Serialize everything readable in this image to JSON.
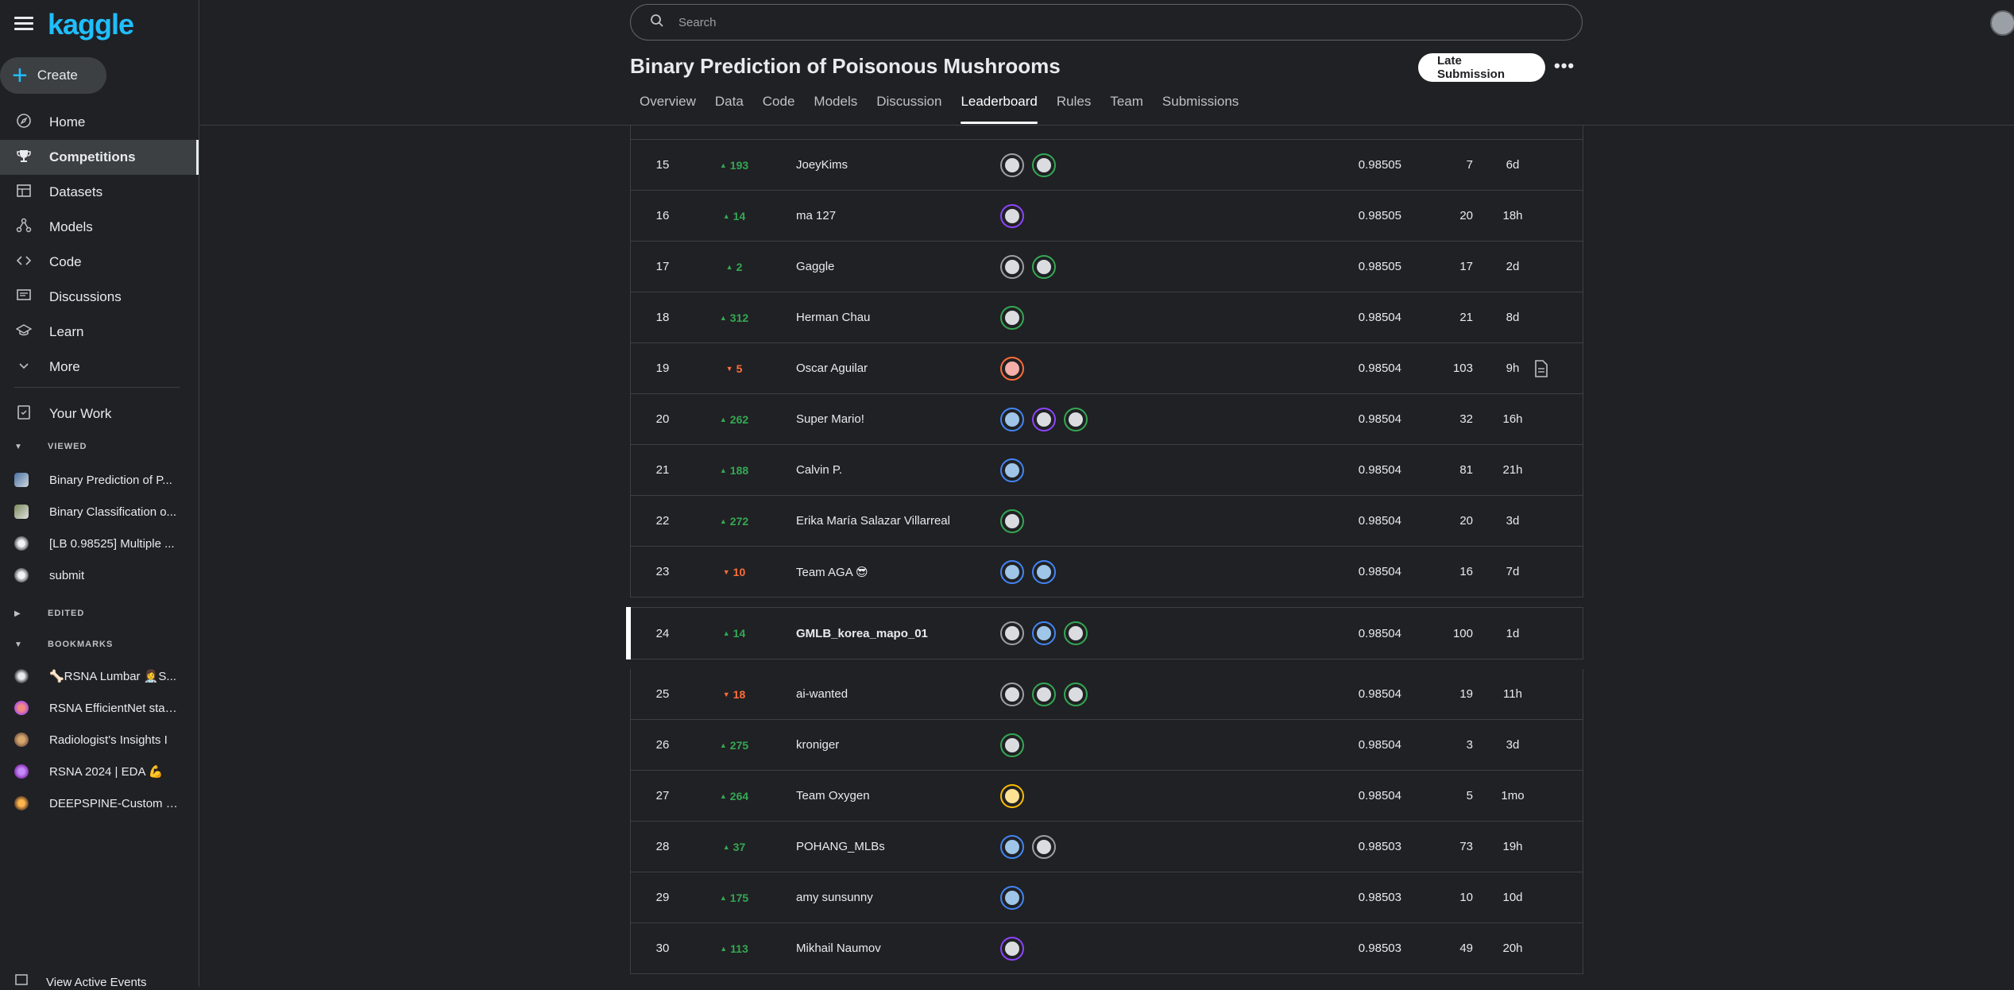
{
  "app": {
    "logo": "kaggle"
  },
  "sidebar": {
    "create_label": "Create",
    "nav": [
      {
        "label": "Home",
        "icon": "compass-icon"
      },
      {
        "label": "Competitions",
        "icon": "trophy-icon",
        "active": true
      },
      {
        "label": "Datasets",
        "icon": "table-icon"
      },
      {
        "label": "Models",
        "icon": "models-icon"
      },
      {
        "label": "Code",
        "icon": "code-icon"
      },
      {
        "label": "Discussions",
        "icon": "discussion-icon"
      },
      {
        "label": "Learn",
        "icon": "learn-icon"
      },
      {
        "label": "More",
        "icon": "chevron-down-icon"
      }
    ],
    "your_work": "Your Work",
    "viewed_label": "VIEWED",
    "viewed": [
      {
        "label": "Binary Prediction of P..."
      },
      {
        "label": "Binary Classification o..."
      },
      {
        "label": "[LB 0.98525] Multiple ..."
      },
      {
        "label": "submit"
      }
    ],
    "edited_label": "EDITED",
    "bookmarks_label": "BOOKMARKS",
    "bookmarks": [
      {
        "label": "🦴RSNA Lumbar 👩‍⚕️S..."
      },
      {
        "label": "RSNA EfficientNet star..."
      },
      {
        "label": "Radiologist's Insights I"
      },
      {
        "label": "RSNA 2024 | EDA 💪"
      },
      {
        "label": "DEEPSPINE-Custom D..."
      }
    ],
    "view_events": "View Active Events"
  },
  "search": {
    "placeholder": "Search"
  },
  "competition": {
    "title": "Binary Prediction of Poisonous Mushrooms",
    "late_submission": "Late Submission",
    "more": "•••",
    "tabs": [
      "Overview",
      "Data",
      "Code",
      "Models",
      "Discussion",
      "Leaderboard",
      "Rules",
      "Team",
      "Submissions"
    ],
    "active_tab": "Leaderboard"
  },
  "leaderboard": {
    "rows": [
      {
        "rank": "15",
        "dir": "up",
        "delta": "193",
        "team": "JoeyKims",
        "members": [
          "gray",
          "g"
        ],
        "score": "0.98505",
        "entries": "7",
        "last": "6d"
      },
      {
        "rank": "16",
        "dir": "up",
        "delta": "14",
        "team": "ma 127",
        "members": [
          "p"
        ],
        "score": "0.98505",
        "entries": "20",
        "last": "18h"
      },
      {
        "rank": "17",
        "dir": "up",
        "delta": "2",
        "team": "Gaggle",
        "members": [
          "gray",
          "g"
        ],
        "score": "0.98505",
        "entries": "17",
        "last": "2d"
      },
      {
        "rank": "18",
        "dir": "up",
        "delta": "312",
        "team": "Herman Chau",
        "members": [
          "g"
        ],
        "score": "0.98504",
        "entries": "21",
        "last": "8d"
      },
      {
        "rank": "19",
        "dir": "down",
        "delta": "5",
        "team": "Oscar Aguilar",
        "members": [
          "o"
        ],
        "score": "0.98504",
        "entries": "103",
        "last": "9h",
        "code": true
      },
      {
        "rank": "20",
        "dir": "up",
        "delta": "262",
        "team": "Super Mario!",
        "members": [
          "b",
          "p",
          "g"
        ],
        "score": "0.98504",
        "entries": "32",
        "last": "16h"
      },
      {
        "rank": "21",
        "dir": "up",
        "delta": "188",
        "team": "Calvin P.",
        "members": [
          "b"
        ],
        "score": "0.98504",
        "entries": "81",
        "last": "21h"
      },
      {
        "rank": "22",
        "dir": "up",
        "delta": "272",
        "team": "Erika María Salazar Villarreal",
        "members": [
          "g"
        ],
        "score": "0.98504",
        "entries": "20",
        "last": "3d"
      },
      {
        "rank": "23",
        "dir": "down",
        "delta": "10",
        "team": "Team AGA 😎",
        "members": [
          "b",
          "b"
        ],
        "score": "0.98504",
        "entries": "16",
        "last": "7d"
      },
      {
        "rank": "24",
        "dir": "up",
        "delta": "14",
        "team": "GMLB_korea_mapo_01",
        "members": [
          "gray",
          "b",
          "g"
        ],
        "score": "0.98504",
        "entries": "100",
        "last": "1d",
        "highlight": true
      },
      {
        "rank": "25",
        "dir": "down",
        "delta": "18",
        "team": "ai-wanted",
        "members": [
          "gray",
          "g",
          "g"
        ],
        "score": "0.98504",
        "entries": "19",
        "last": "11h"
      },
      {
        "rank": "26",
        "dir": "up",
        "delta": "275",
        "team": "kroniger",
        "members": [
          "g"
        ],
        "score": "0.98504",
        "entries": "3",
        "last": "3d"
      },
      {
        "rank": "27",
        "dir": "up",
        "delta": "264",
        "team": "Team Oxygen",
        "members": [
          "y"
        ],
        "score": "0.98504",
        "entries": "5",
        "last": "1mo"
      },
      {
        "rank": "28",
        "dir": "up",
        "delta": "37",
        "team": "POHANG_MLBs",
        "members": [
          "b",
          "gray"
        ],
        "score": "0.98503",
        "entries": "73",
        "last": "19h"
      },
      {
        "rank": "29",
        "dir": "up",
        "delta": "175",
        "team": "amy sunsunny",
        "members": [
          "b"
        ],
        "score": "0.98503",
        "entries": "10",
        "last": "10d"
      },
      {
        "rank": "30",
        "dir": "up",
        "delta": "113",
        "team": "Mikhail Naumov",
        "members": [
          "p"
        ],
        "score": "0.98503",
        "entries": "49",
        "last": "20h"
      }
    ]
  }
}
